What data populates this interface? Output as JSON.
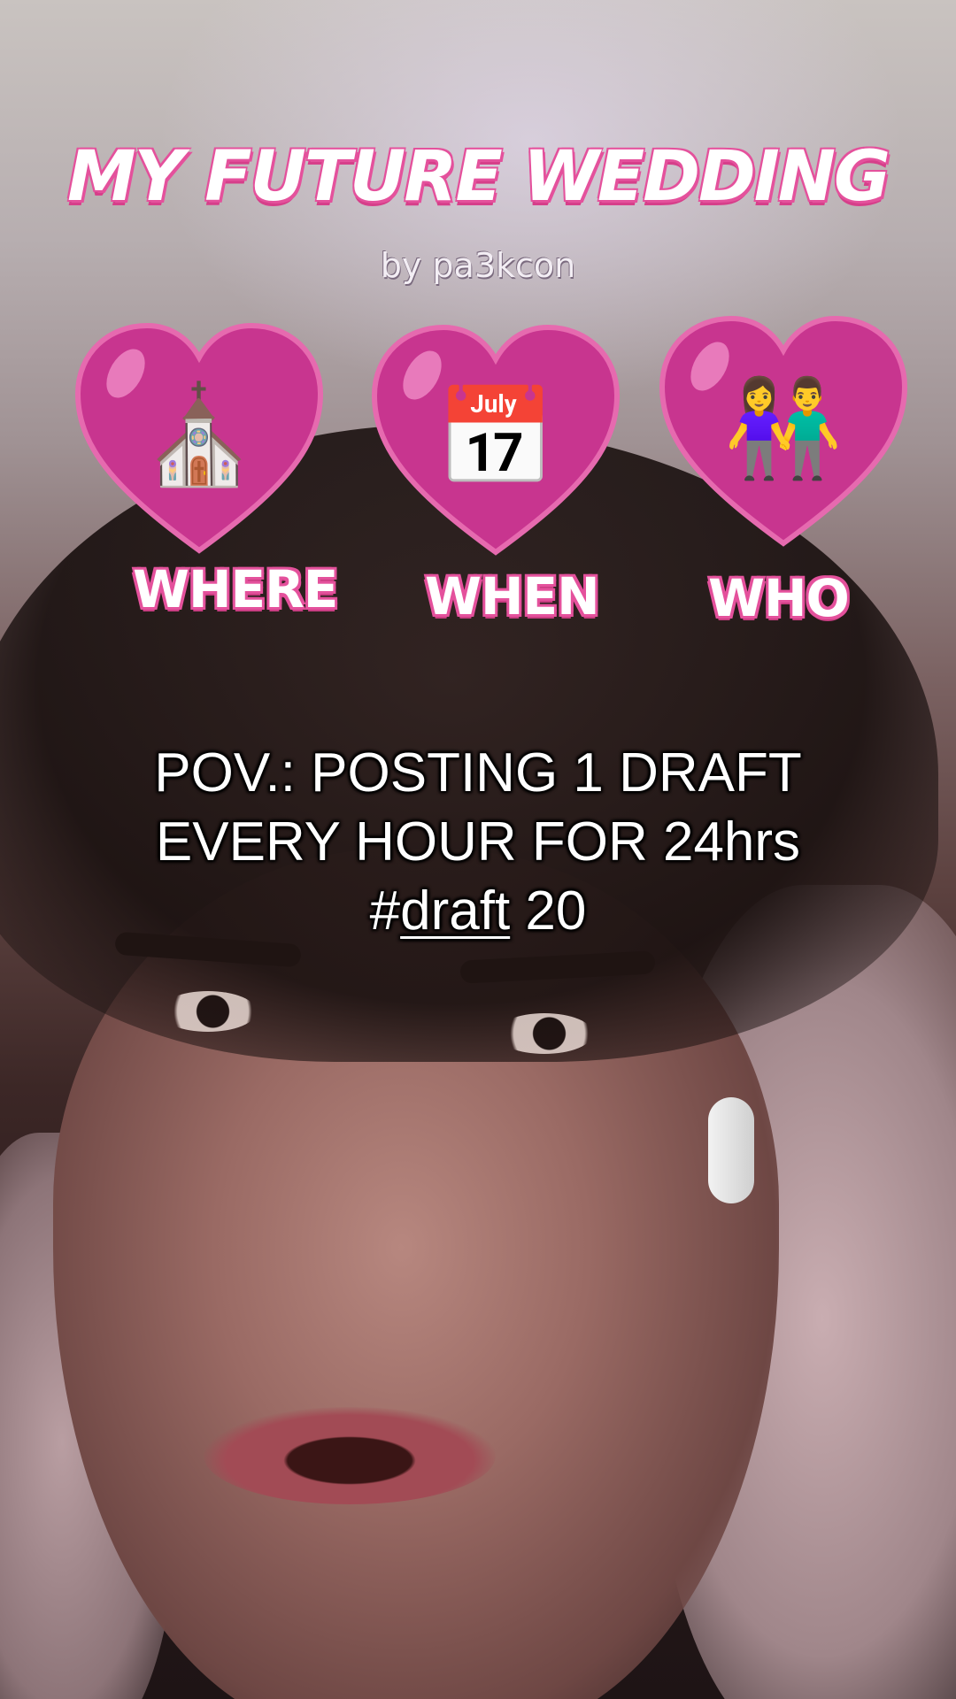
{
  "overlay": {
    "title": "MY FUTURE WEDDING",
    "byline": "by pa3kcon",
    "slots": [
      {
        "label": "WHERE",
        "icon": "church-icon",
        "glyph": "⛪"
      },
      {
        "label": "WHEN",
        "icon": "calendar-icon",
        "glyph": "📅"
      },
      {
        "label": "WHO",
        "icon": "couple-icon",
        "glyph": "👫"
      }
    ],
    "accent_color": "#e4519c",
    "heart_color": "#c8358f"
  },
  "caption": {
    "line1": "POV.: POSTING 1 DRAFT",
    "line2": "EVERY HOUR FOR 24hrs",
    "hash_prefix": "#",
    "hashtag": "draft",
    "suffix": " 20"
  }
}
